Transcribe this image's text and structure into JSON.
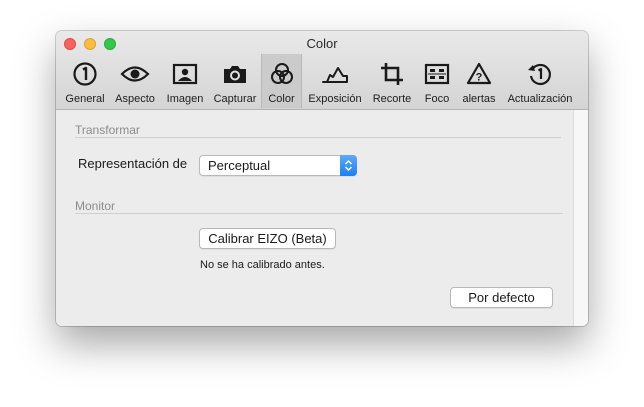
{
  "window": {
    "title": "Color"
  },
  "toolbar": {
    "items": [
      {
        "label": "General",
        "icon": "general-icon"
      },
      {
        "label": "Aspecto",
        "icon": "eye-icon"
      },
      {
        "label": "Imagen",
        "icon": "image-icon"
      },
      {
        "label": "Capturar",
        "icon": "camera-icon"
      },
      {
        "label": "Color",
        "icon": "color-circles-icon",
        "selected": true
      },
      {
        "label": "Exposición",
        "icon": "exposure-icon"
      },
      {
        "label": "Recorte",
        "icon": "crop-icon"
      },
      {
        "label": "Foco",
        "icon": "focus-icon"
      },
      {
        "label": "alertas",
        "icon": "warning-icon"
      },
      {
        "label": "Actualización",
        "icon": "update-icon"
      }
    ]
  },
  "transform": {
    "header": "Transformar",
    "rendering_label": "Representación de",
    "rendering_value": "Perceptual"
  },
  "monitor": {
    "header": "Monitor",
    "calibrate_button": "Calibrar EIZO (Beta)",
    "calibrate_status": "No se ha calibrado antes."
  },
  "footer": {
    "default_button": "Por defecto"
  },
  "colors": {
    "accent": "#1c7ff3",
    "close": "#fc605c",
    "minimize": "#fdbc40",
    "zoom": "#34c84a"
  }
}
